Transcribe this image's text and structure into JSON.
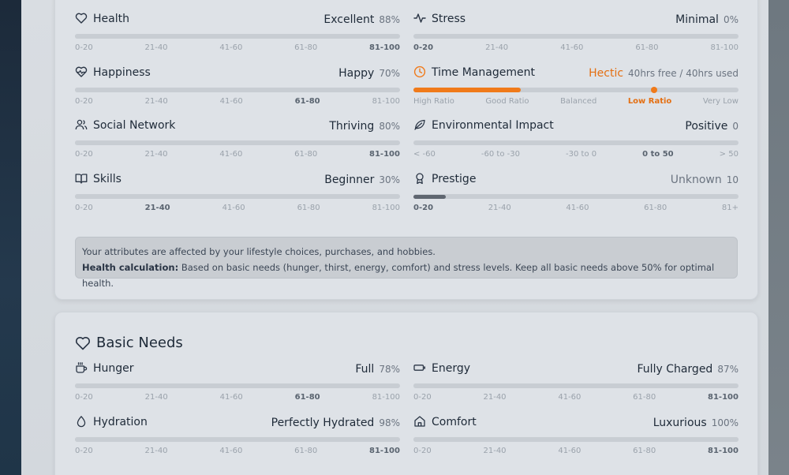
{
  "attributes": {
    "health": {
      "name": "Health",
      "status": "Excellent",
      "value": "88%",
      "level": 0.88,
      "ticks": [
        "0-20",
        "21-40",
        "41-60",
        "61-80",
        "81-100"
      ],
      "active_tick": 4
    },
    "stress": {
      "name": "Stress",
      "status": "Minimal",
      "value": "0%",
      "level": 0,
      "ticks": [
        "0-20",
        "21-40",
        "41-60",
        "61-80",
        "81-100"
      ],
      "active_tick": 0
    },
    "happiness": {
      "name": "Happiness",
      "status": "Happy",
      "value": "70%",
      "level": 0.7,
      "ticks": [
        "0-20",
        "21-40",
        "41-60",
        "61-80",
        "81-100"
      ],
      "active_tick": 3
    },
    "time_management": {
      "name": "Time Management",
      "status": "Hectic",
      "value": "40hrs free / 40hrs used",
      "level": 0.33,
      "marker_level": 0.74,
      "ticks": [
        "High Ratio",
        "Good Ratio",
        "Balanced",
        "Low Ratio",
        "Very Low"
      ],
      "active_tick": 3
    },
    "social": {
      "name": "Social Network",
      "status": "Thriving",
      "value": "80%",
      "level": 0.8,
      "ticks": [
        "0-20",
        "21-40",
        "41-60",
        "61-80",
        "81-100"
      ],
      "active_tick": 4
    },
    "environment": {
      "name": "Environmental Impact",
      "status": "Positive",
      "value": "0",
      "level": 0,
      "ticks": [
        "< -60",
        "-60 to -30",
        "-30 to 0",
        "0 to 50",
        "> 50"
      ],
      "active_tick": 3
    },
    "skills": {
      "name": "Skills",
      "status": "Beginner",
      "value": "30%",
      "level": 0.3,
      "ticks": [
        "0-20",
        "21-40",
        "41-60",
        "61-80",
        "81-100"
      ],
      "active_tick": 1
    },
    "prestige": {
      "name": "Prestige",
      "status": "Unknown",
      "value": "10",
      "level": 0.1,
      "ticks": [
        "0-20",
        "21-40",
        "41-60",
        "61-80",
        "81+"
      ],
      "active_tick": 0
    }
  },
  "notice": {
    "line1": "Your attributes are affected by your lifestyle choices, purchases, and hobbies.",
    "label": "Health calculation:",
    "line2": "Based on basic needs (hunger, thirst, energy, comfort) and stress levels. Keep all basic needs above 50% for optimal health."
  },
  "basic_needs": {
    "title": "Basic Needs",
    "hunger": {
      "name": "Hunger",
      "status": "Full",
      "value": "78%",
      "level": 0.78,
      "ticks": [
        "0-20",
        "21-40",
        "41-60",
        "61-80",
        "81-100"
      ],
      "active_tick": 3
    },
    "energy": {
      "name": "Energy",
      "status": "Fully Charged",
      "value": "87%",
      "level": 0.87,
      "ticks": [
        "0-20",
        "21-40",
        "41-60",
        "61-80",
        "81-100"
      ],
      "active_tick": 4
    },
    "hydration": {
      "name": "Hydration",
      "status": "Perfectly Hydrated",
      "value": "98%",
      "level": 0.98,
      "ticks": [
        "0-20",
        "21-40",
        "41-60",
        "61-80",
        "81-100"
      ],
      "active_tick": 4
    },
    "comfort": {
      "name": "Comfort",
      "status": "Luxurious",
      "value": "100%",
      "level": 1.0,
      "ticks": [
        "0-20",
        "21-40",
        "41-60",
        "61-80",
        "81-100"
      ],
      "active_tick": 4
    }
  },
  "colors": {
    "fill": "#c8cdd3",
    "accent_orange": "#f07a1a",
    "prestige_fill": "#5f6670"
  }
}
